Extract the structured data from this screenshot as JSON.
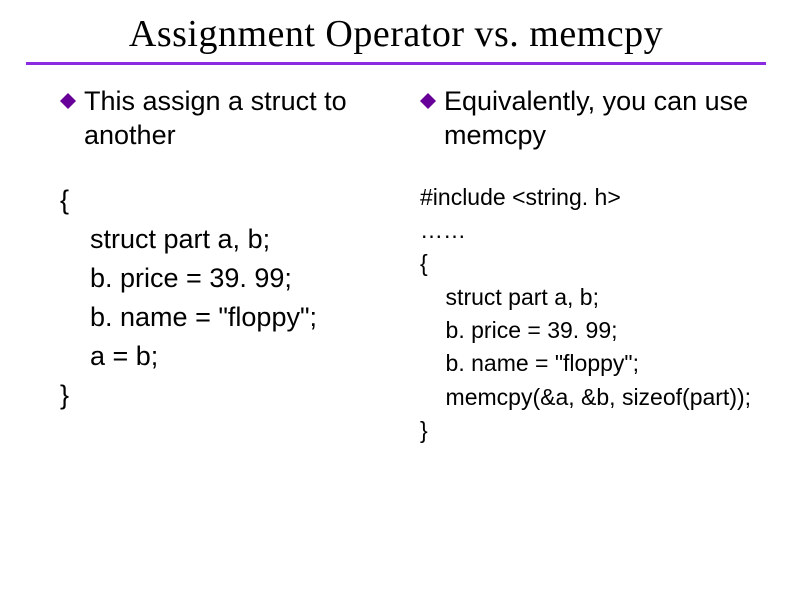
{
  "title": "Assignment Operator vs. memcpy",
  "left": {
    "bullet": "This assign a struct to another",
    "code": "{\n    struct part a, b;\n    b. price = 39. 99;\n    b. name = \"floppy\";\n    a = b;\n}"
  },
  "right": {
    "bullet": "Equivalently, you can use memcpy",
    "code": "#include <string. h>\n……\n{\n    struct part a, b;\n    b. price = 39. 99;\n    b. name = \"floppy\";\n    memcpy(&a, &b, sizeof(part));\n}"
  }
}
